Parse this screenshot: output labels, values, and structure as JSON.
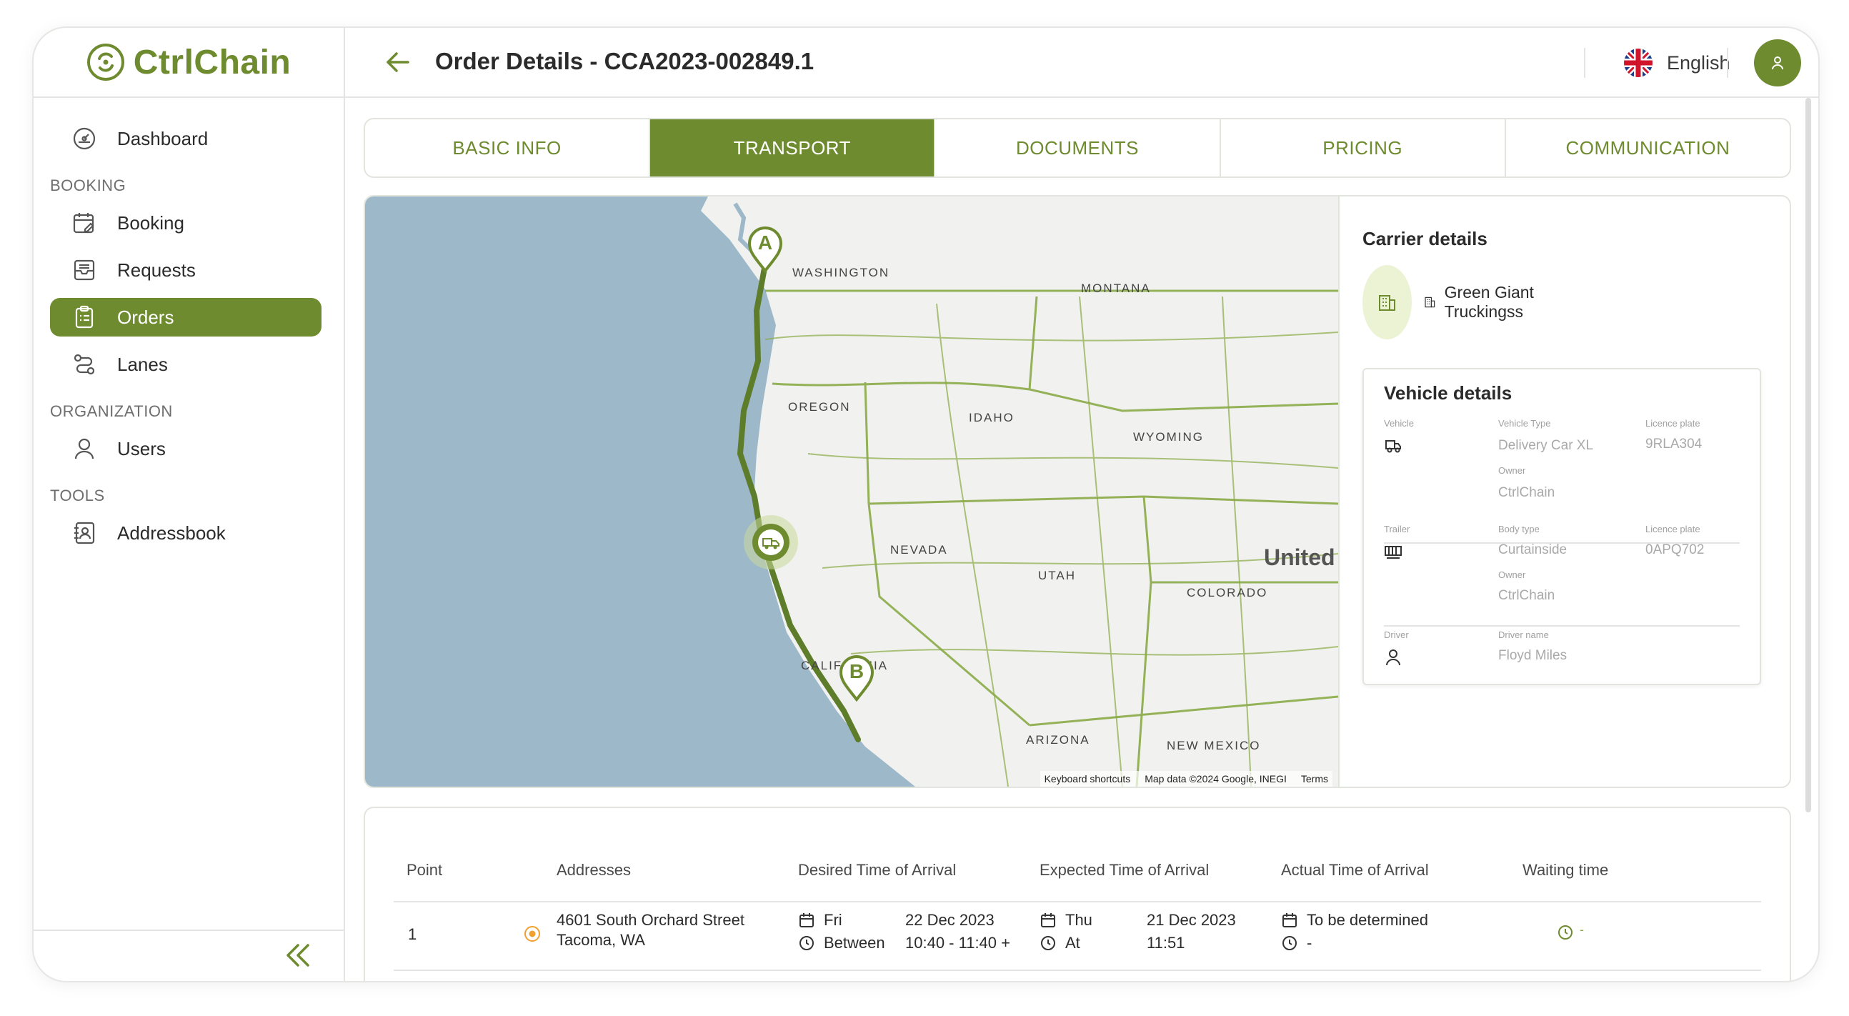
{
  "brand": {
    "name": "CtrlChain",
    "color": "#6e8b2f"
  },
  "sidebar": {
    "dashboard": "Dashboard",
    "sections": {
      "booking": "BOOKING",
      "organization": "ORGANIZATION",
      "tools": "TOOLS"
    },
    "items": {
      "booking": "Booking",
      "requests": "Requests",
      "orders": "Orders",
      "lanes": "Lanes",
      "users": "Users",
      "addressbook": "Addressbook"
    },
    "active": "orders"
  },
  "header": {
    "title": "Order Details - CCA2023-002849.1",
    "language": "English"
  },
  "tabs": [
    "BASIC INFO",
    "TRANSPORT",
    "DOCUMENTS",
    "PRICING",
    "COMMUNICATION"
  ],
  "active_tab": "TRANSPORT",
  "map": {
    "labels": {
      "washington": "WASHINGTON",
      "montana": "MONTANA",
      "oregon": "OREGON",
      "idaho": "IDAHO",
      "wyoming": "WYOMING",
      "nevada": "NEVADA",
      "utah": "UTAH",
      "colorado": "COLORADO",
      "california": "CALIFORNIA",
      "arizona": "ARIZONA",
      "new_mexico": "NEW MEXICO",
      "united": "United"
    },
    "markers": {
      "start": "A",
      "end": "B"
    },
    "footer": {
      "shortcuts": "Keyboard shortcuts",
      "data": "Map data ©2024 Google, INEGI",
      "terms": "Terms"
    },
    "colors": {
      "water": "#9db8c9",
      "land": "#f1f1ef",
      "route": "#5e7d2a",
      "border": "#8aab47"
    }
  },
  "carrier": {
    "title": "Carrier details",
    "name": "Green Giant Truckingss"
  },
  "vehicle_details": {
    "title": "Vehicle details",
    "vehicle": {
      "label": "Vehicle",
      "type_label": "Vehicle Type",
      "type": "Delivery Car XL",
      "plate_label": "Licence plate",
      "plate": "9RLA304",
      "owner_label": "Owner",
      "owner": "CtrlChain"
    },
    "trailer": {
      "label": "Trailer",
      "type_label": "Body type",
      "type": "Curtainside",
      "plate_label": "Licence plate",
      "plate": "0APQ702",
      "owner_label": "Owner",
      "owner": "CtrlChain"
    },
    "driver": {
      "label": "Driver",
      "name_label": "Driver name",
      "name": "Floyd Miles"
    }
  },
  "stops_table": {
    "headers": [
      "Point",
      "Addresses",
      "Desired Time of Arrival",
      "Expected Time of Arrival",
      "Actual Time of Arrival",
      "Waiting time"
    ],
    "rows": [
      {
        "point": "1",
        "address_line1": "4601 South Orchard Street",
        "address_line2": "Tacoma, WA",
        "desired": {
          "day": "Fri",
          "date": "22 Dec 2023",
          "mode": "Between",
          "time": "10:40 - 11:40 +"
        },
        "expected": {
          "day": "Thu",
          "date": "21 Dec 2023",
          "mode": "At",
          "time": "11:51"
        },
        "actual": {
          "date": "To be determined",
          "time": "-"
        },
        "waiting": "-"
      }
    ]
  }
}
